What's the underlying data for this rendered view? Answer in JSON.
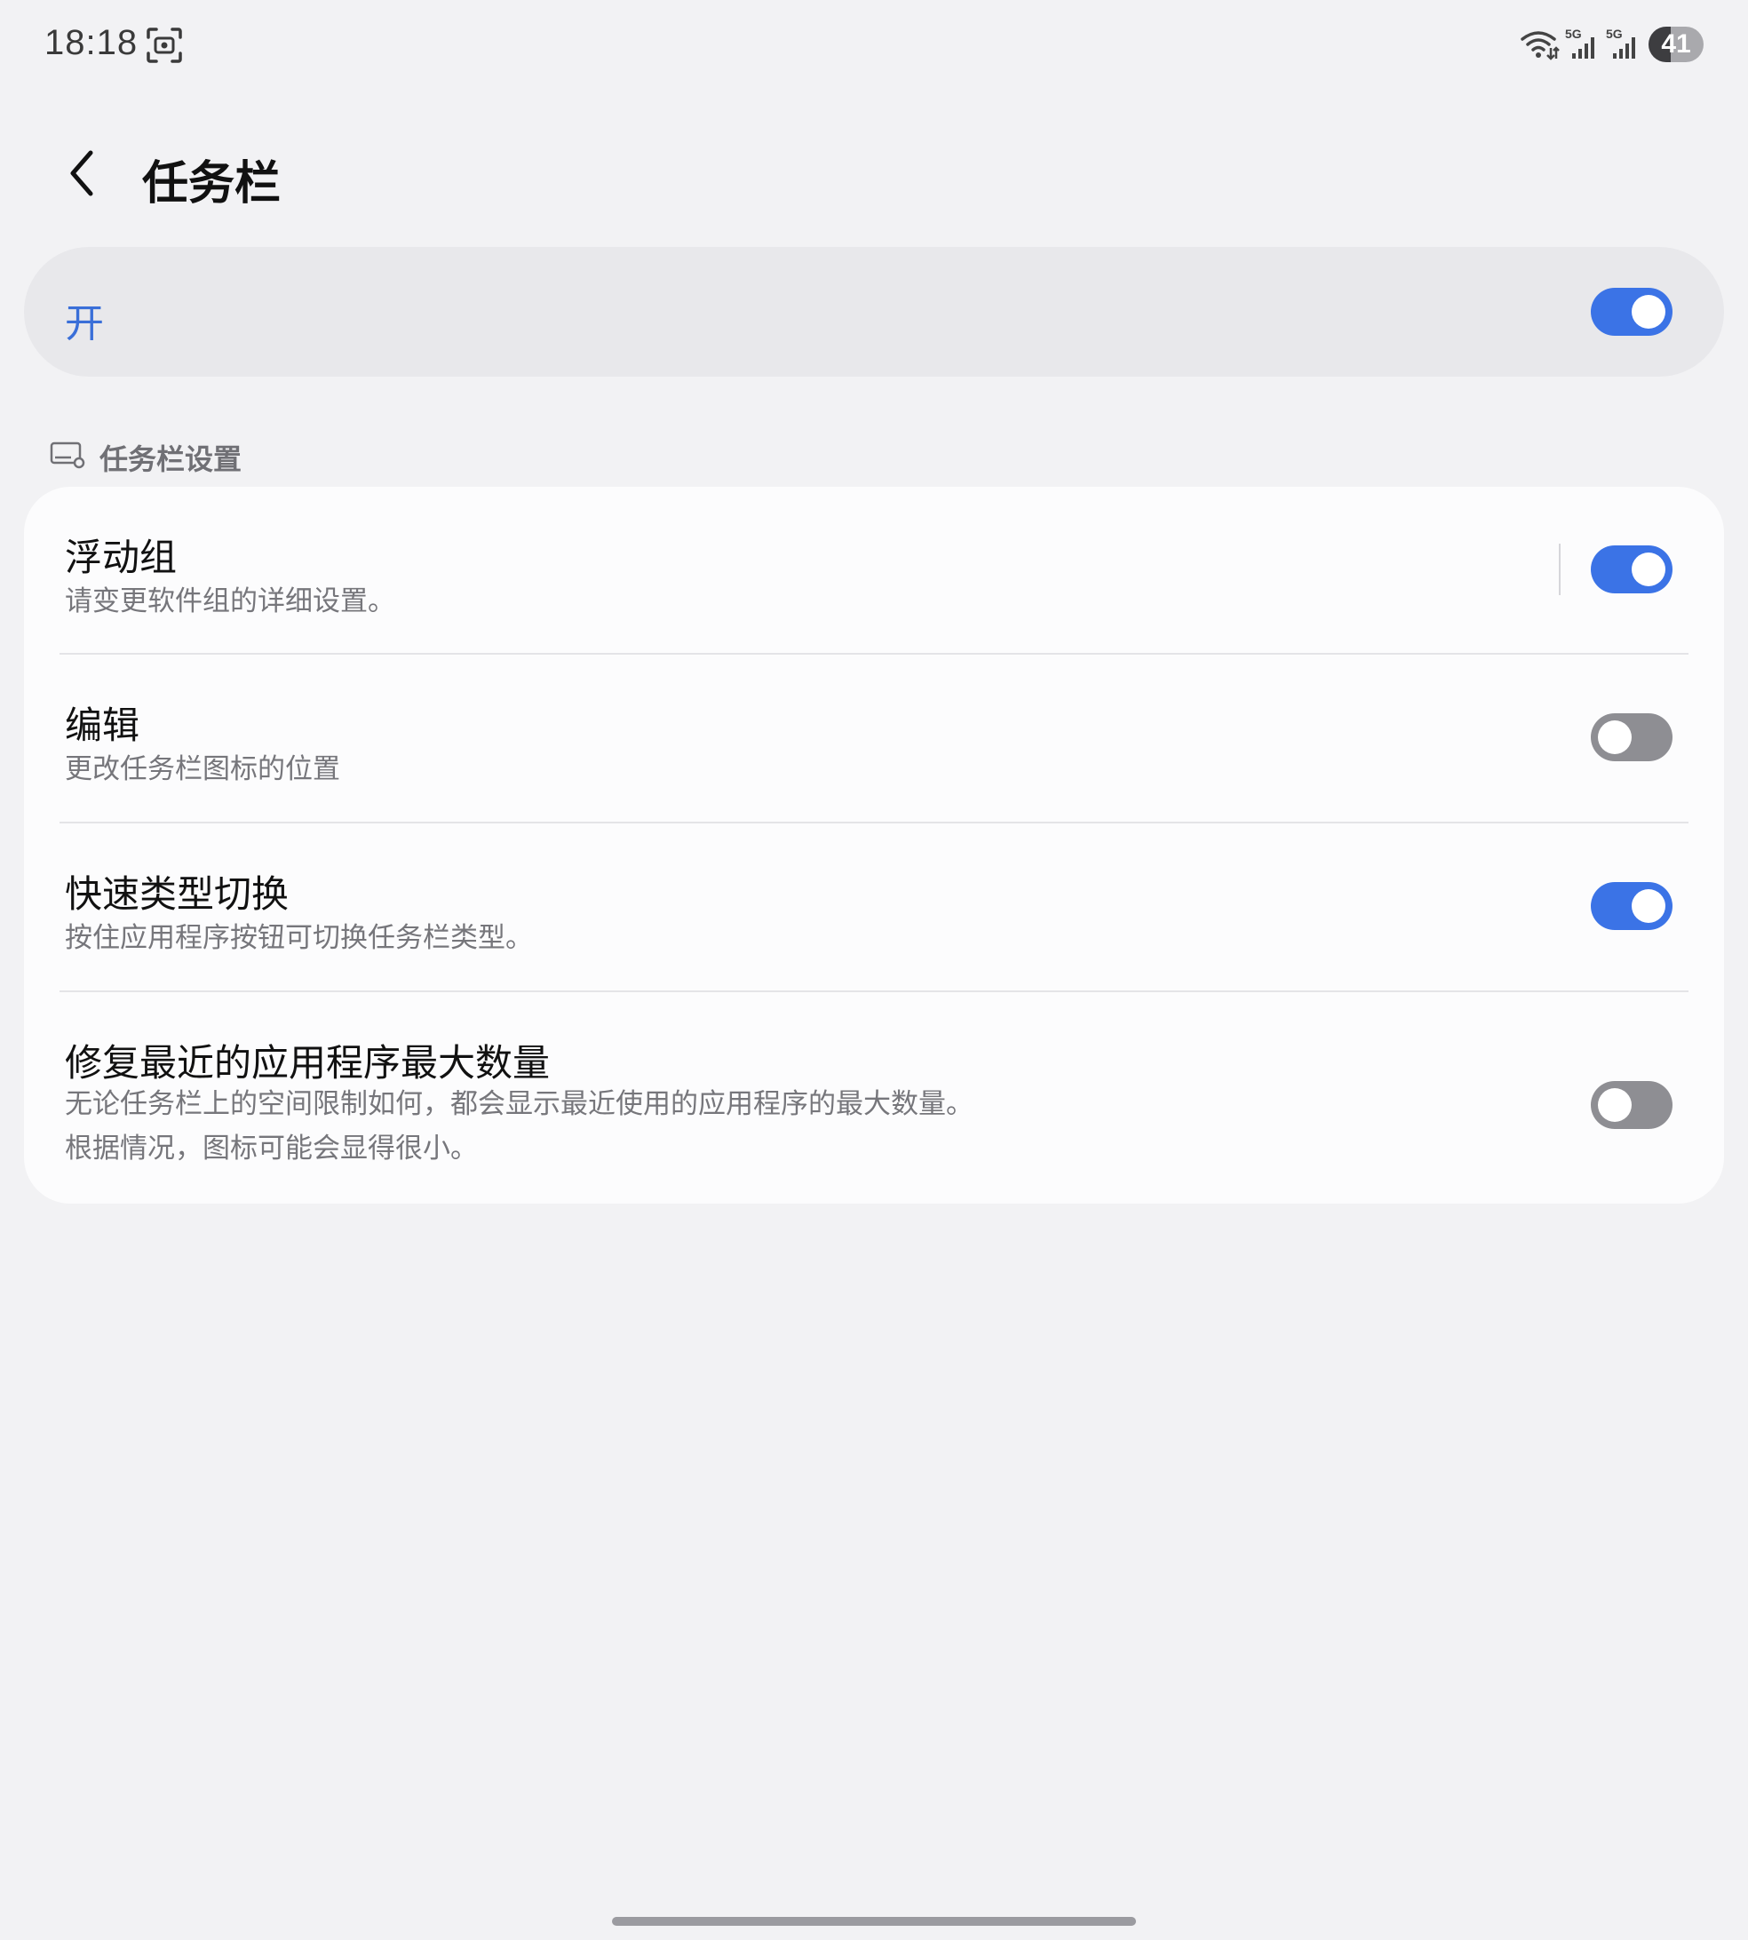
{
  "status_bar": {
    "time": "18:18",
    "screenshot_icon": "screenshot-icon",
    "wifi_icon": "wifi-icon",
    "signal_1_label": "5G",
    "signal_2_label": "5G",
    "battery_level": "41",
    "battery_percent": 41
  },
  "header": {
    "back_icon": "chevron-left-icon",
    "title": "任务栏"
  },
  "master_switch": {
    "label": "开",
    "enabled": true
  },
  "section": {
    "icon": "taskbar-settings-icon",
    "title": "任务栏设置"
  },
  "settings": [
    {
      "title": "浮动组",
      "description": "请变更软件组的详细设置。",
      "enabled": true
    },
    {
      "title": "编辑",
      "description": "更改任务栏图标的位置",
      "enabled": false
    },
    {
      "title": "快速类型切换",
      "description": "按住应用程序按钮可切换任务栏类型。",
      "enabled": true
    },
    {
      "title": "修复最近的应用程序最大数量",
      "description_line1": "无论任务栏上的空间限制如何，都会显示最近使用的应用程序的最大数量。",
      "description_line2": "根据情况，图标可能会显得很小。",
      "enabled": false
    }
  ],
  "colors": {
    "accent": "#3b73e6",
    "toggle_off": "#8e8e93",
    "background": "#f2f2f4",
    "card": "#fcfcfd"
  }
}
